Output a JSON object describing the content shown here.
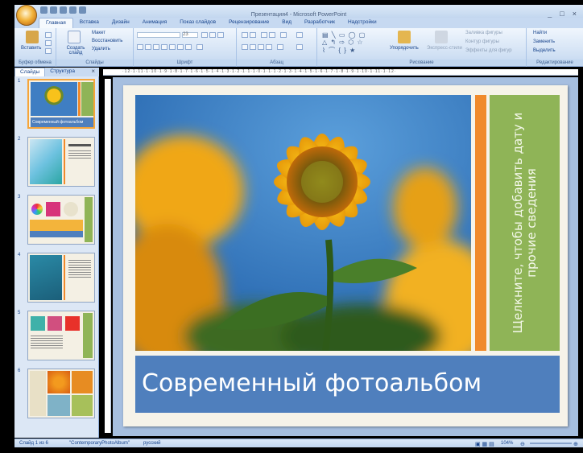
{
  "window": {
    "title": "Презентация4 - Microsoft PowerPoint",
    "controls": [
      "_",
      "□",
      "×"
    ]
  },
  "ribbon_tabs": [
    "Главная",
    "Вставка",
    "Дизайн",
    "Анимация",
    "Показ слайдов",
    "Рецензирование",
    "Вид",
    "Разработчик",
    "Надстройки"
  ],
  "active_tab": "Главная",
  "clipboard": {
    "paste": "Вставить",
    "label": "Буфер обмена"
  },
  "slides_group": {
    "create": "Создать слайд",
    "layout": "Макет",
    "reset": "Восстановить",
    "delete": "Удалить",
    "label": "Слайды"
  },
  "font_group": {
    "size": "23",
    "label": "Шрифт"
  },
  "paragraph_group": {
    "label": "Абзац"
  },
  "drawing_group": {
    "arrange": "Упорядочить",
    "quick_styles": "Экспресс-стили",
    "fill": "Заливка фигуры",
    "outline": "Контур фигуры",
    "effects": "Эффекты для фигур",
    "label": "Рисование"
  },
  "editing_group": {
    "find": "Найти",
    "replace": "Заменить",
    "select": "Выделить",
    "label": "Редактирование"
  },
  "pane_tabs": {
    "slides": "Слайды",
    "outline": "Структура"
  },
  "thumbnails": [
    {
      "num": "1"
    },
    {
      "num": "2"
    },
    {
      "num": "3"
    },
    {
      "num": "4"
    },
    {
      "num": "5"
    },
    {
      "num": "6"
    }
  ],
  "thumb1_caption": "Современный фотоальбом",
  "ruler": "·12·1·11·1·10·1·9·1·8·1·7·1·6·1·5·1·4·1·3·1·2·1·1·1·0·1·1·1·2·1·3·1·4·1·5·1·6·1·7·1·8·1·9·1·10·1·11·1·12·",
  "slide": {
    "title": "Современный фотоальбом",
    "side_text": "Щелкните, чтобы добавить дату и прочие сведения"
  },
  "status": {
    "slide_info": "Слайд 1 из 6",
    "theme": "\"ContemporaryPhotoAlbum\"",
    "language": "русский",
    "zoom": "104%"
  },
  "colors": {
    "accent_orange": "#f08a2b",
    "green_panel": "#8fb457",
    "blue_title": "#4f7fbd",
    "slide_bg": "#f6f3e9"
  }
}
